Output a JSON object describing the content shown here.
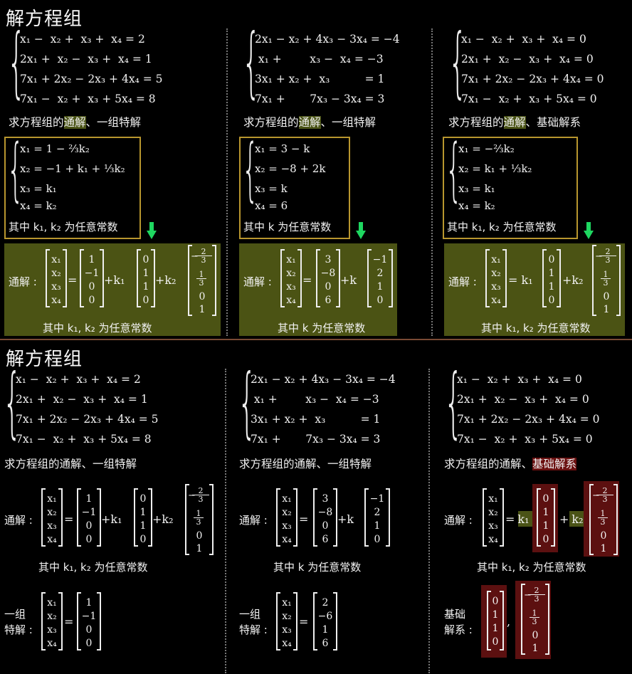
{
  "titles": {
    "top": "解方程组",
    "bottom": "解方程组"
  },
  "systems": {
    "s1": [
      "x₁ −  x₂ +  x₃ +  x₄ = 2",
      "2x₁ +  x₂ −  x₃ +  x₄ = 1",
      "7x₁ + 2x₂ − 2x₃ + 4x₄ = 5",
      "7x₁ −  x₂ +  x₃ + 5x₄ = 8"
    ],
    "s2": [
      "2x₁ − x₂ + 4x₃ − 3x₄ = −4",
      " x₁ +        x₃ −  x₄ = −3",
      "3x₁ + x₂ +  x₃          = 1",
      "7x₁ +       7x₃ − 3x₄ = 3"
    ],
    "s3": [
      "x₁ −  x₂ +  x₃ +  x₄ = 0",
      "2x₁ +  x₂ −  x₃ +  x₄ = 0",
      "7x₁ + 2x₂ − 2x₃ + 4x₄ = 0",
      "7x₁ −  x₂ +  x₃ + 5x₄ = 0"
    ]
  },
  "questions": {
    "q1_pre": "求方程组的",
    "q1_hl": "通解",
    "q1_post": "、一组特解",
    "q2_pre": "求方程组的",
    "q2_hl": "通解",
    "q2_post": "、一组特解",
    "q3_pre": "求方程组的",
    "q3_hl": "通解",
    "q3_post": "、基础解系",
    "b1": "求方程组的通解、一组特解",
    "b2": "求方程组的通解、一组特解",
    "b3_pre": "求方程组的通解、",
    "b3_hl": "基础解系"
  },
  "solutions": {
    "s1": [
      "x₁ = 1 − ⅔k₂",
      "x₂ = −1 + k₁ + ⅓k₂",
      "x₃ = k₁",
      "x₄ = k₂"
    ],
    "s2": [
      "x₁ = 3 − k",
      "x₂ = −8 + 2k",
      "x₃ = k",
      "x₄ = 6"
    ],
    "s3": [
      "x₁ = −⅔k₂",
      "x₂ = k₁ + ⅓k₂",
      "x₃ = k₁",
      "x₄ = k₂"
    ]
  },
  "constants": {
    "c1": "其中 k₁, k₂ 为任意常数",
    "c2": "其中 k 为任意常数",
    "c3": "其中 k₁, k₂ 为任意常数"
  },
  "labels": {
    "general": "通解 :",
    "particular_1": "一组",
    "particular_2": "特解",
    "basis_1": "基础",
    "basis_2": "解系",
    "k1": "k₁",
    "k2": "k₂",
    "k": "k",
    "eq": "=",
    "plus": "+",
    "comma": ","
  },
  "vectors": {
    "x": [
      "x₁",
      "x₂",
      "x₃",
      "x₄"
    ],
    "p1": [
      "1",
      "−1",
      "0",
      "0"
    ],
    "v1": [
      "0",
      "1",
      "1",
      "0"
    ],
    "w1_rest": [
      "0",
      "1"
    ],
    "p2": [
      "3",
      "−8",
      "0",
      "6"
    ],
    "v2": [
      "−1",
      "2",
      "1",
      "0"
    ],
    "pp2": [
      "2",
      "−6",
      "1",
      "6"
    ],
    "frac_two_thirds": {
      "sign": "−",
      "n": "2",
      "d": "3"
    },
    "frac_one_third": {
      "n": "1",
      "d": "3"
    }
  },
  "colors": {
    "highlight_green": "#4a5316",
    "highlight_red": "#6b1010",
    "box_gold": "#b8962e",
    "arrow": "#1ed760",
    "separator": "#7a4a34"
  }
}
